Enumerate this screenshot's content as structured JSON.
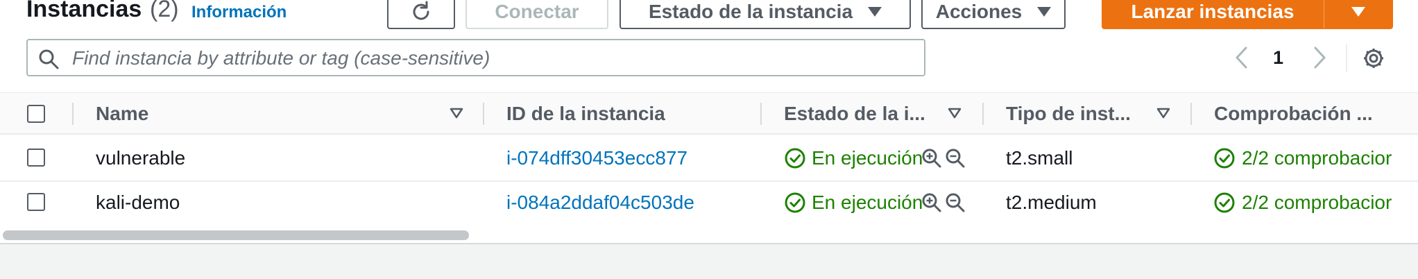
{
  "header": {
    "title": "Instancias",
    "count": "(2)",
    "info_link": "Información"
  },
  "toolbar": {
    "connect_label": "Conectar",
    "instance_state_label": "Estado de la instancia",
    "actions_label": "Acciones",
    "launch_label": "Lanzar instancias"
  },
  "search": {
    "placeholder": "Find instancia by attribute or tag (case-sensitive)"
  },
  "pagination": {
    "current_page": "1"
  },
  "table": {
    "columns": {
      "name": "Name",
      "instance_id": "ID de la instancia",
      "instance_state": "Estado de la i...",
      "instance_type": "Tipo de inst...",
      "status_check": "Comprobación ..."
    },
    "rows": [
      {
        "name": "vulnerable",
        "instance_id": "i-074dff30453ecc877",
        "instance_state": "En ejecución",
        "instance_type": "t2.small",
        "status_check": "2/2 comprobacior"
      },
      {
        "name": "kali-demo",
        "instance_id": "i-084a2ddaf04c503de",
        "instance_state": "En ejecución",
        "instance_type": "t2.medium",
        "status_check": "2/2 comprobacior"
      }
    ]
  },
  "colors": {
    "primary": "#ec7211",
    "link": "#0073bb",
    "success": "#1d8102",
    "text": "#16191f",
    "muted": "#545b64"
  },
  "icons": {
    "refresh": "refresh-icon",
    "search": "search-icon",
    "prev": "chevron-left-icon",
    "next": "chevron-right-icon",
    "settings": "gear-icon",
    "filter": "sort-triangle-icon",
    "running": "check-circle-icon",
    "zoom_in": "zoom-in-icon",
    "zoom_out": "zoom-out-icon"
  }
}
